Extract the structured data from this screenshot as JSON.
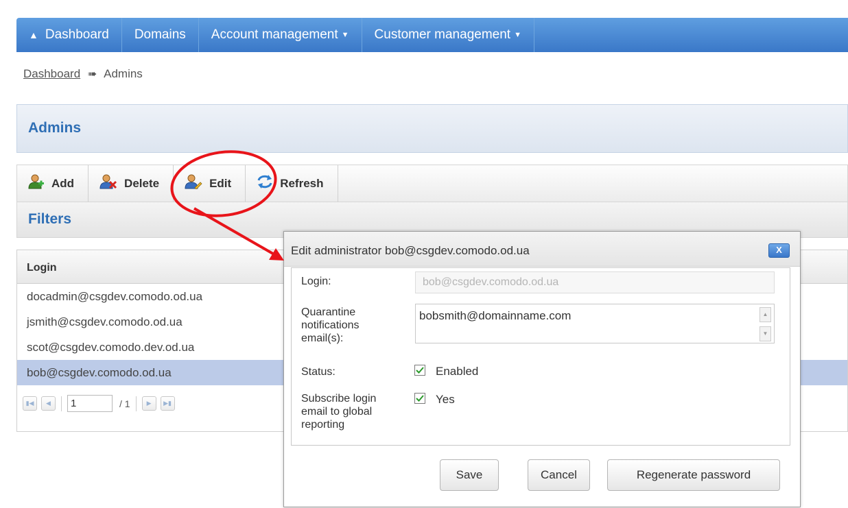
{
  "nav": {
    "items": [
      {
        "label": "Dashboard",
        "icon": "home-icon"
      },
      {
        "label": "Domains"
      },
      {
        "label": "Account management",
        "dropdown": true
      },
      {
        "label": "Customer management",
        "dropdown": true
      }
    ]
  },
  "breadcrumb": {
    "root": "Dashboard",
    "current": "Admins"
  },
  "page": {
    "title": "Admins",
    "filters_title": "Filters"
  },
  "toolbar": {
    "add": "Add",
    "delete": "Delete",
    "edit": "Edit",
    "refresh": "Refresh"
  },
  "grid": {
    "column": "Login",
    "rows": [
      "docadmin@csgdev.comodo.od.ua",
      "jsmith@csgdev.comodo.od.ua",
      "scot@csgdev.comodo.dev.od.ua",
      "bob@csgdev.comodo.od.ua"
    ],
    "selected_row": 3
  },
  "pager": {
    "page": "1",
    "total": "/ 1"
  },
  "dialog": {
    "title": "Edit administrator bob@csgdev.comodo.od.ua",
    "close_label": "X",
    "login_label": "Login:",
    "login_value": "bob@csgdev.comodo.od.ua",
    "quarantine_label_lines": [
      "Quarantine",
      "notifications",
      "email(s):"
    ],
    "quarantine_value": "bobsmith@domainname.com",
    "status_label": "Status:",
    "status_checked": true,
    "status_option": "Enabled",
    "subscribe_label_lines": [
      "Subscribe login",
      "email to global",
      "reporting"
    ],
    "subscribe_checked": true,
    "subscribe_option": "Yes",
    "save": "Save",
    "cancel": "Cancel",
    "regenerate": "Regenerate password"
  },
  "colors": {
    "nav": "#4a8ad6",
    "heading": "#2f6fb5",
    "selected_row": "#bccbe8",
    "annotation": "#e8141a"
  }
}
